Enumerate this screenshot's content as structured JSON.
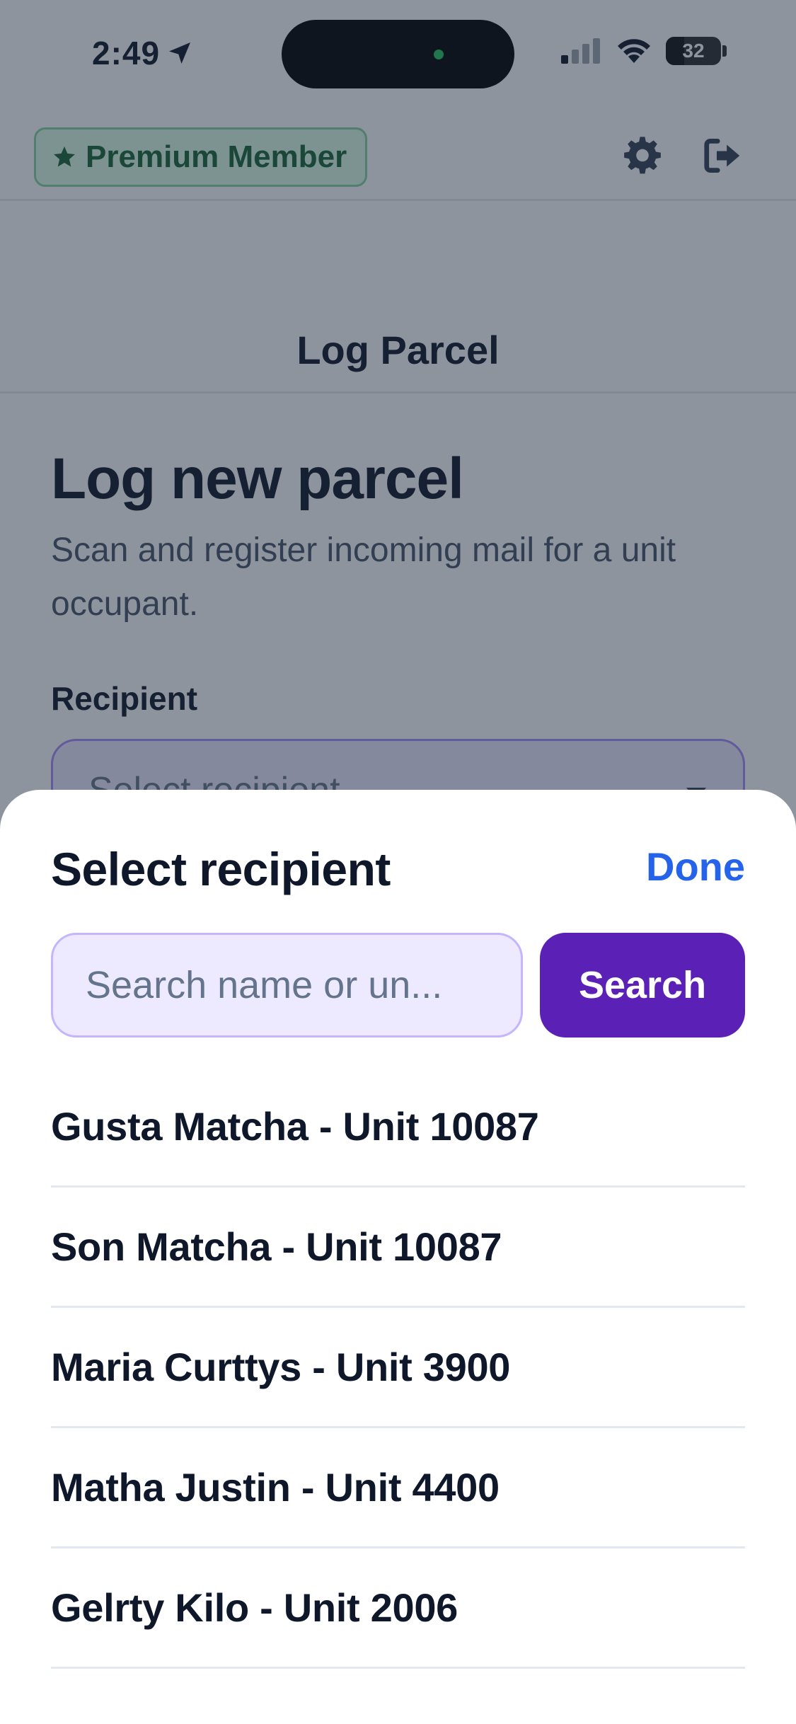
{
  "status_bar": {
    "time": "2:49",
    "battery": "32"
  },
  "header": {
    "badge_label": "Premium Member",
    "title": "Log Parcel"
  },
  "page": {
    "heading": "Log new parcel",
    "subtitle": "Scan and register incoming mail for a unit occupant.",
    "recipient_label": "Recipient",
    "recipient_placeholder": "Select recipient"
  },
  "sheet": {
    "title": "Select recipient",
    "done_label": "Done",
    "search_placeholder": "Search name or un...",
    "search_button": "Search",
    "recipients": [
      {
        "label": "Gusta Matcha - Unit 10087"
      },
      {
        "label": "Son Matcha - Unit 10087"
      },
      {
        "label": "Maria Curttys - Unit 3900"
      },
      {
        "label": "Matha Justin - Unit 4400"
      },
      {
        "label": "Gelrty Kilo - Unit 2006"
      }
    ]
  },
  "colors": {
    "accent": "#5b21b6",
    "link": "#2563eb",
    "badge_green": "#166534"
  }
}
